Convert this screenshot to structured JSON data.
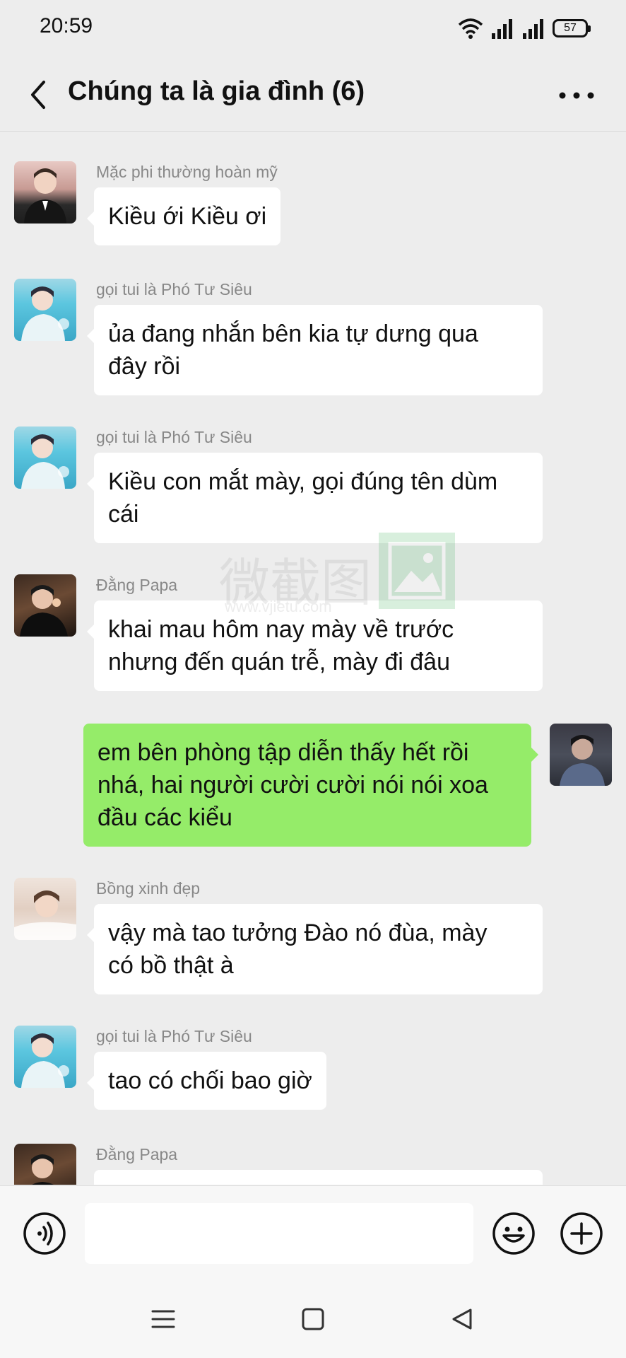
{
  "status": {
    "time": "20:59",
    "battery": "57",
    "icons": [
      "wifi-icon",
      "signal-icon",
      "signal-icon",
      "battery-icon"
    ]
  },
  "header": {
    "title": "Chúng ta là gia đình (6)",
    "back_icon": "chevron-left-icon",
    "more_icon": "more-dots-icon"
  },
  "messages": [
    {
      "sender": "Mặc phi thường hoàn mỹ",
      "text": "Kiều ới Kiều ơi",
      "direction": "in"
    },
    {
      "sender": "gọi tui là Phó Tư Siêu",
      "text": "ủa đang nhắn bên kia tự dưng qua\nđây rồi",
      "direction": "in"
    },
    {
      "sender": "gọi tui là Phó Tư Siêu",
      "text": "Kiều con mắt mày, gọi đúng tên dùm\ncái",
      "direction": "in"
    },
    {
      "sender": "Đằng Papa",
      "text": "khai mau hôm nay mày về trước\nnhưng đến quán trễ, mày đi đâu",
      "direction": "in"
    },
    {
      "sender": "",
      "text": "em bên phòng tập diễn thấy hết rồi\nnhá, hai người cười cười nói nói xoa\nđầu các kiểu",
      "direction": "out"
    },
    {
      "sender": "Bồng xinh đẹp",
      "text": "vậy mà tao tưởng Đào nó đùa, mày\ncó bồ thật à",
      "direction": "in"
    },
    {
      "sender": "gọi tui là Phó Tư Siêu",
      "text": "tao có chối bao giờ",
      "direction": "in"
    },
    {
      "sender": "Đằng Papa",
      "text": "",
      "direction": "in"
    }
  ],
  "watermark": {
    "text": "微截图",
    "url": "www.vjietu.com"
  },
  "input": {
    "placeholder": "",
    "voice_icon": "voice-icon",
    "emoji_icon": "emoji-icon",
    "plus_icon": "plus-icon"
  },
  "nav": {
    "icons": [
      "menu-icon",
      "home-icon",
      "back-triangle-icon"
    ]
  },
  "colors": {
    "background": "#ededed",
    "incoming_bubble": "#ffffff",
    "outgoing_bubble": "#95ec69"
  }
}
